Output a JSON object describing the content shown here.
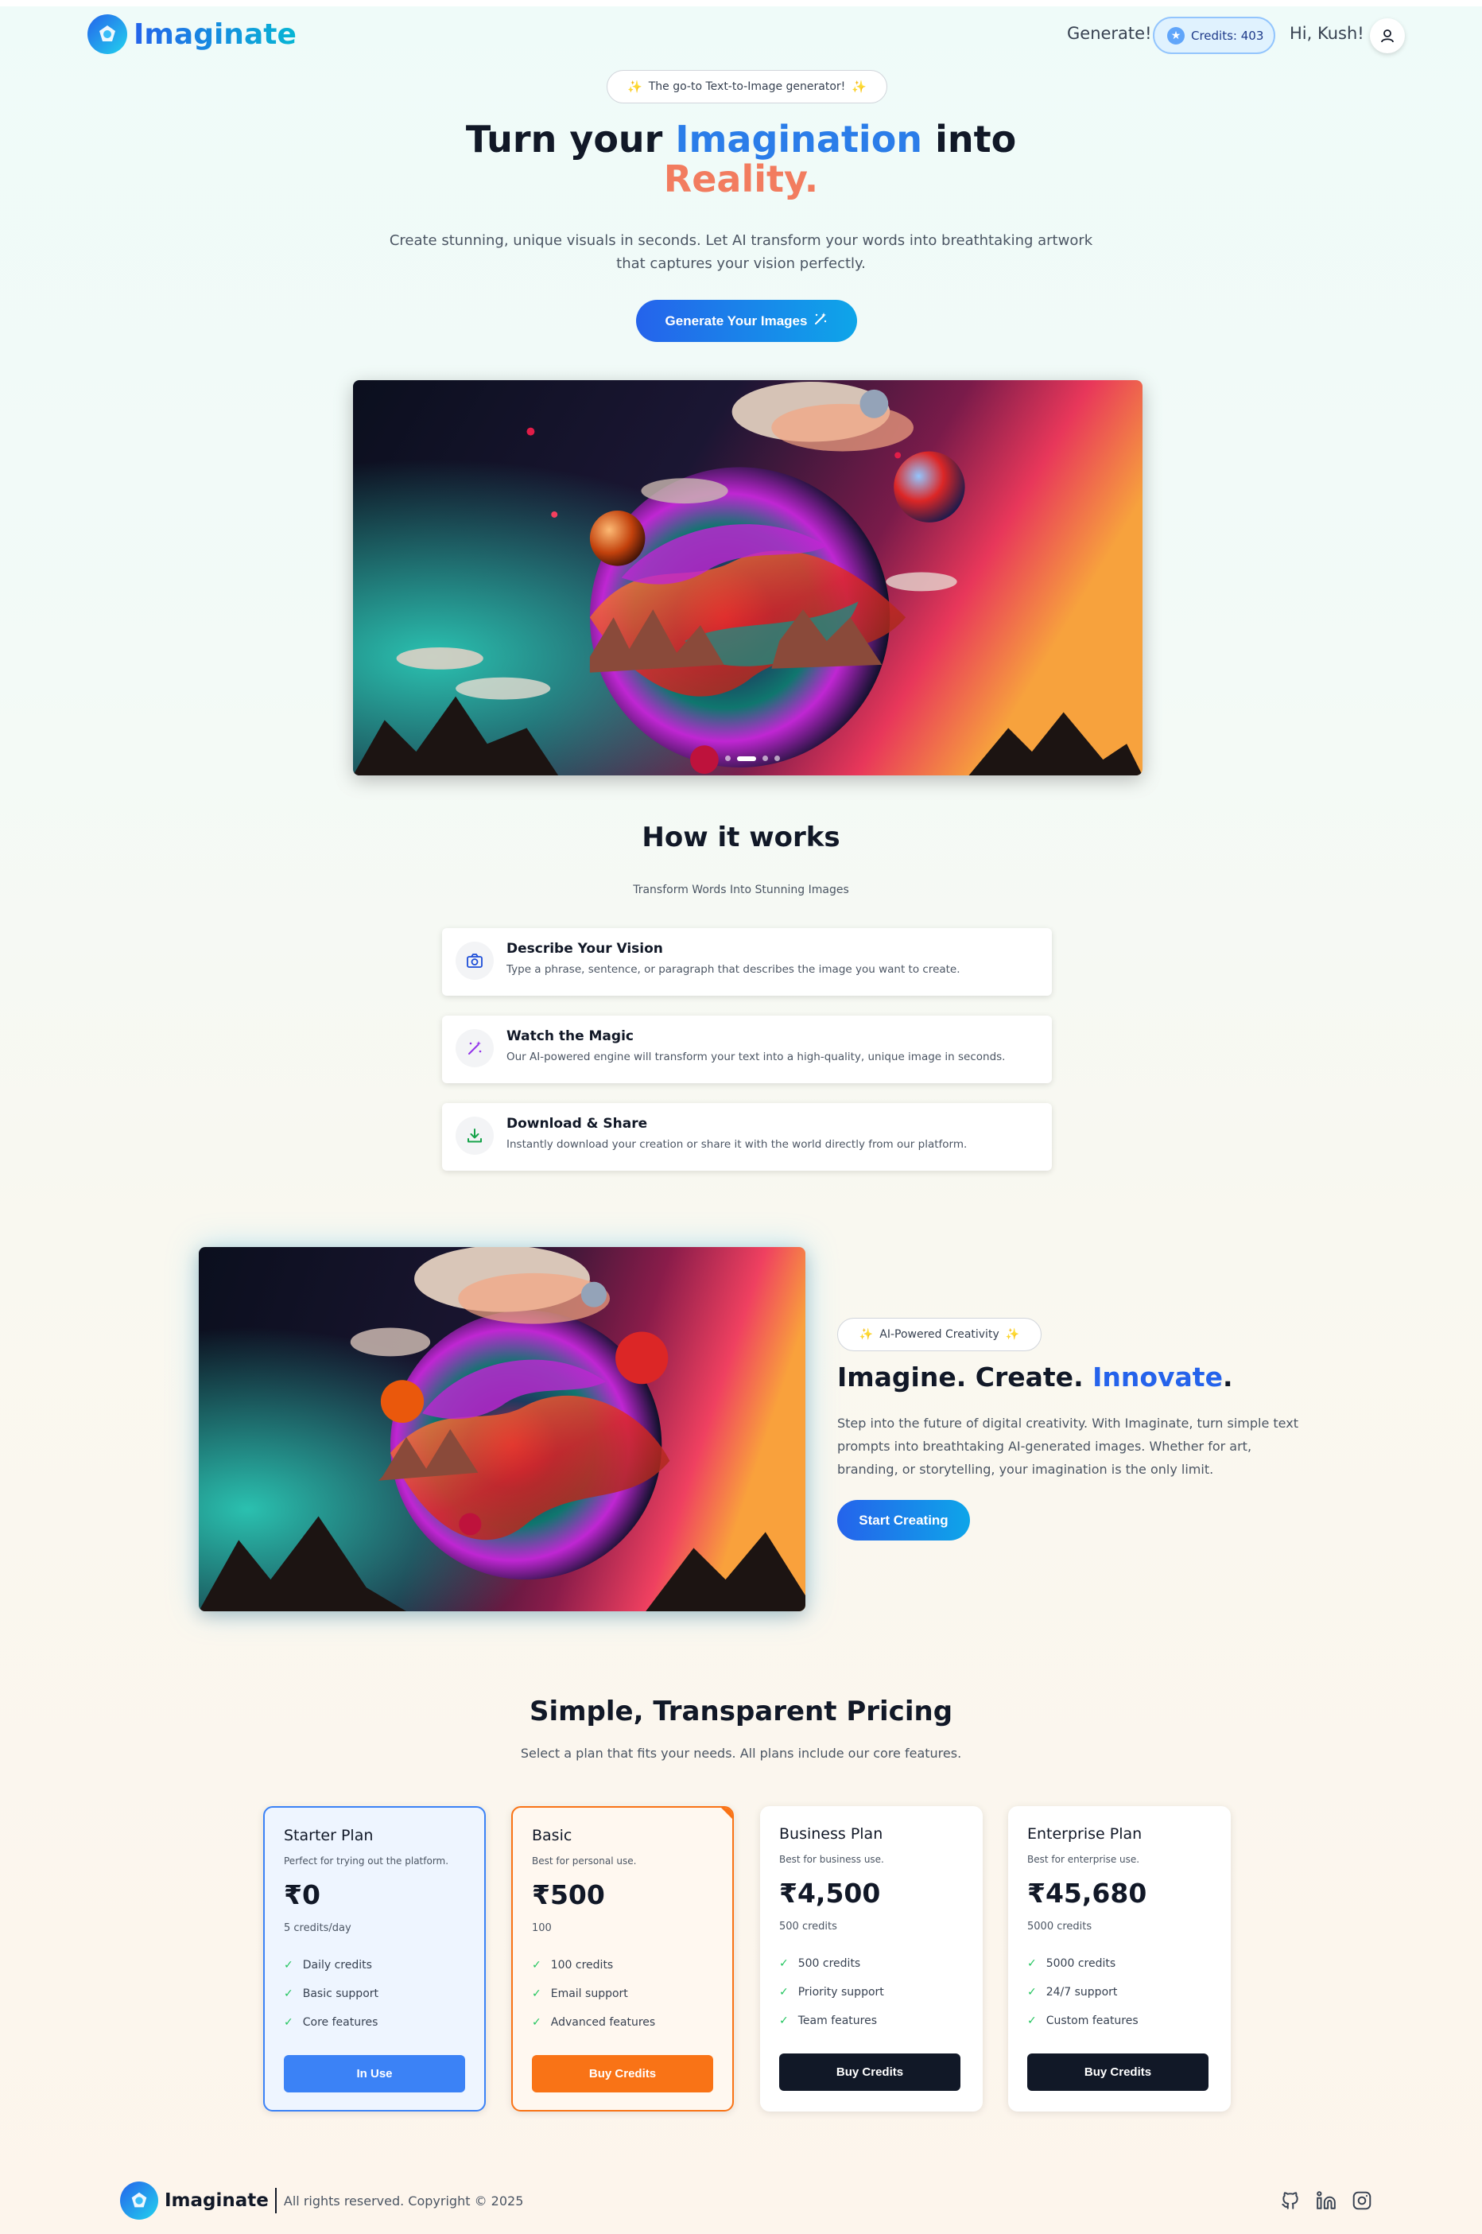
{
  "nav": {
    "brand": "Imaginate",
    "generate_link": "Generate!",
    "credits": "Credits: 403",
    "greeting": "Hi, Kush!"
  },
  "hero": {
    "tagline": "The go-to Text-to-Image generator!",
    "title_part1": "Turn your ",
    "title_highlight": "Imagination",
    "title_part2": " into",
    "title_line2": "Reality.",
    "description": "Create stunning, unique visuals in seconds. Let AI transform your words into breathtaking artwork that captures your vision perfectly.",
    "cta": "Generate Your Images"
  },
  "how_it_works": {
    "title": "How it works",
    "subtitle": "Transform Words Into Stunning Images",
    "steps": [
      {
        "title": "Describe Your Vision",
        "desc": "Type a phrase, sentence, or paragraph that describes the image you want to create.",
        "icon": "camera-icon"
      },
      {
        "title": "Watch the Magic",
        "desc": "Our AI-powered engine will transform your text into a high-quality, unique image in seconds.",
        "icon": "magic-wand-icon"
      },
      {
        "title": "Download & Share",
        "desc": "Instantly download your creation or share it with the world directly from our platform.",
        "icon": "download-icon"
      }
    ]
  },
  "feature": {
    "pill": "AI-Powered Creativity",
    "title_part1": "Imagine. Create. ",
    "title_highlight": "Innovate",
    "title_end": ".",
    "description": "Step into the future of digital creativity. With Imaginate, turn simple text prompts into breathtaking AI-generated images. Whether for art, branding, or storytelling, your imagination is the only limit.",
    "cta": "Start Creating"
  },
  "pricing": {
    "title": "Simple, Transparent Pricing",
    "subtitle": "Select a plan that fits your needs. All plans include our core features.",
    "plans": [
      {
        "name": "Starter Plan",
        "tag": "Perfect for trying out the platform.",
        "price": "₹0",
        "credits": "5 credits/day",
        "features": [
          "Daily credits",
          "Basic support",
          "Core features"
        ],
        "button": "In Use"
      },
      {
        "name": "Basic",
        "tag": "Best for personal use.",
        "price": "₹500",
        "credits": "100",
        "features": [
          "100 credits",
          "Email support",
          "Advanced features"
        ],
        "button": "Buy Credits"
      },
      {
        "name": "Business Plan",
        "tag": "Best for business use.",
        "price": "₹4,500",
        "credits": "500 credits",
        "features": [
          "500 credits",
          "Priority support",
          "Team features"
        ],
        "button": "Buy Credits"
      },
      {
        "name": "Enterprise Plan",
        "tag": "Best for enterprise use.",
        "price": "₹45,680",
        "credits": "5000 credits",
        "features": [
          "5000 credits",
          "24/7 support",
          "Custom features"
        ],
        "button": "Buy Credits"
      }
    ]
  },
  "footer": {
    "brand": "Imaginate",
    "copyright": "All rights reserved. Copyright © 2025",
    "social_icons": [
      "github-icon",
      "linkedin-icon",
      "instagram-icon"
    ]
  },
  "colors": {
    "brand_blue": "#2563eb",
    "accent_cyan": "#0ea5e9",
    "coral": "#f27c5f",
    "orange": "#f97316",
    "dark": "#111827"
  }
}
